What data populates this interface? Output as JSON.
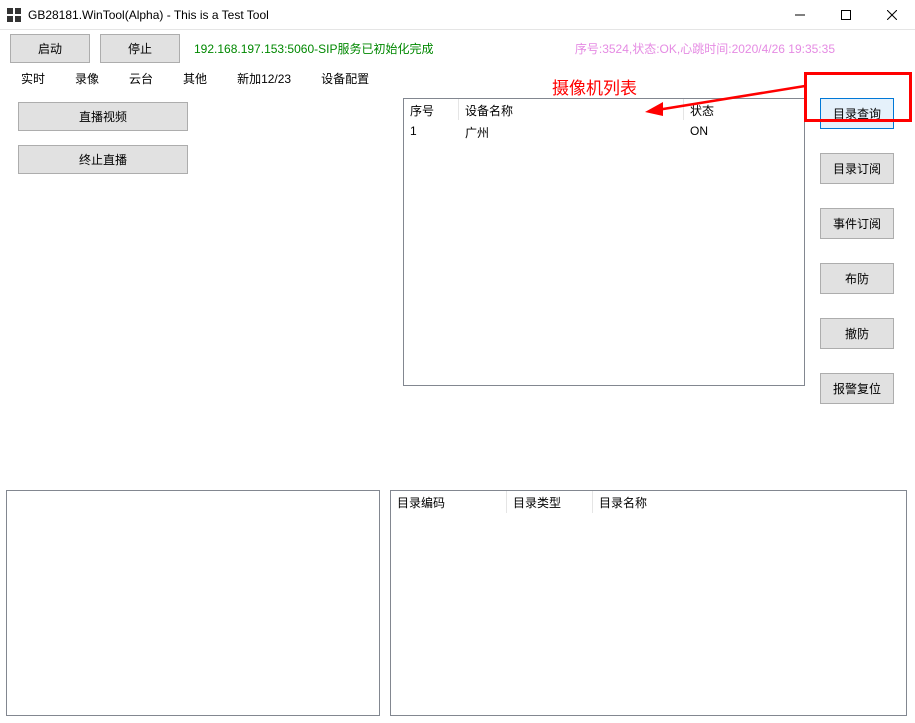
{
  "window": {
    "title": "GB28181.WinTool(Alpha) - This is a Test Tool"
  },
  "topbar": {
    "start_label": "启动",
    "stop_label": "停止",
    "status_green": "192.168.197.153:5060-SIP服务已初始化完成",
    "status_pink": "序号:3524,状态:OK,心跳时间:2020/4/26 19:35:35"
  },
  "tabs": {
    "items": [
      "实时",
      "录像",
      "云台",
      "其他",
      "新加12/23",
      "设备配置"
    ]
  },
  "leftbuttons": {
    "live_video": "直播视频",
    "stop_live": "终止直播"
  },
  "device_table": {
    "headers": {
      "c1": "序号",
      "c2": "设备名称",
      "c3": "状态"
    },
    "rows": [
      {
        "c1": "1",
        "c2": "广州",
        "c3": "ON"
      }
    ]
  },
  "rightbuttons": {
    "catalog_query": "目录查询",
    "catalog_subscribe": "目录订阅",
    "event_subscribe": "事件订阅",
    "arm": "布防",
    "disarm": "撤防",
    "alarm_reset": "报警复位"
  },
  "annotation": {
    "text": "摄像机列表"
  },
  "catalog_table": {
    "headers": {
      "c1": "目录编码",
      "c2": "目录类型",
      "c3": "目录名称"
    }
  }
}
